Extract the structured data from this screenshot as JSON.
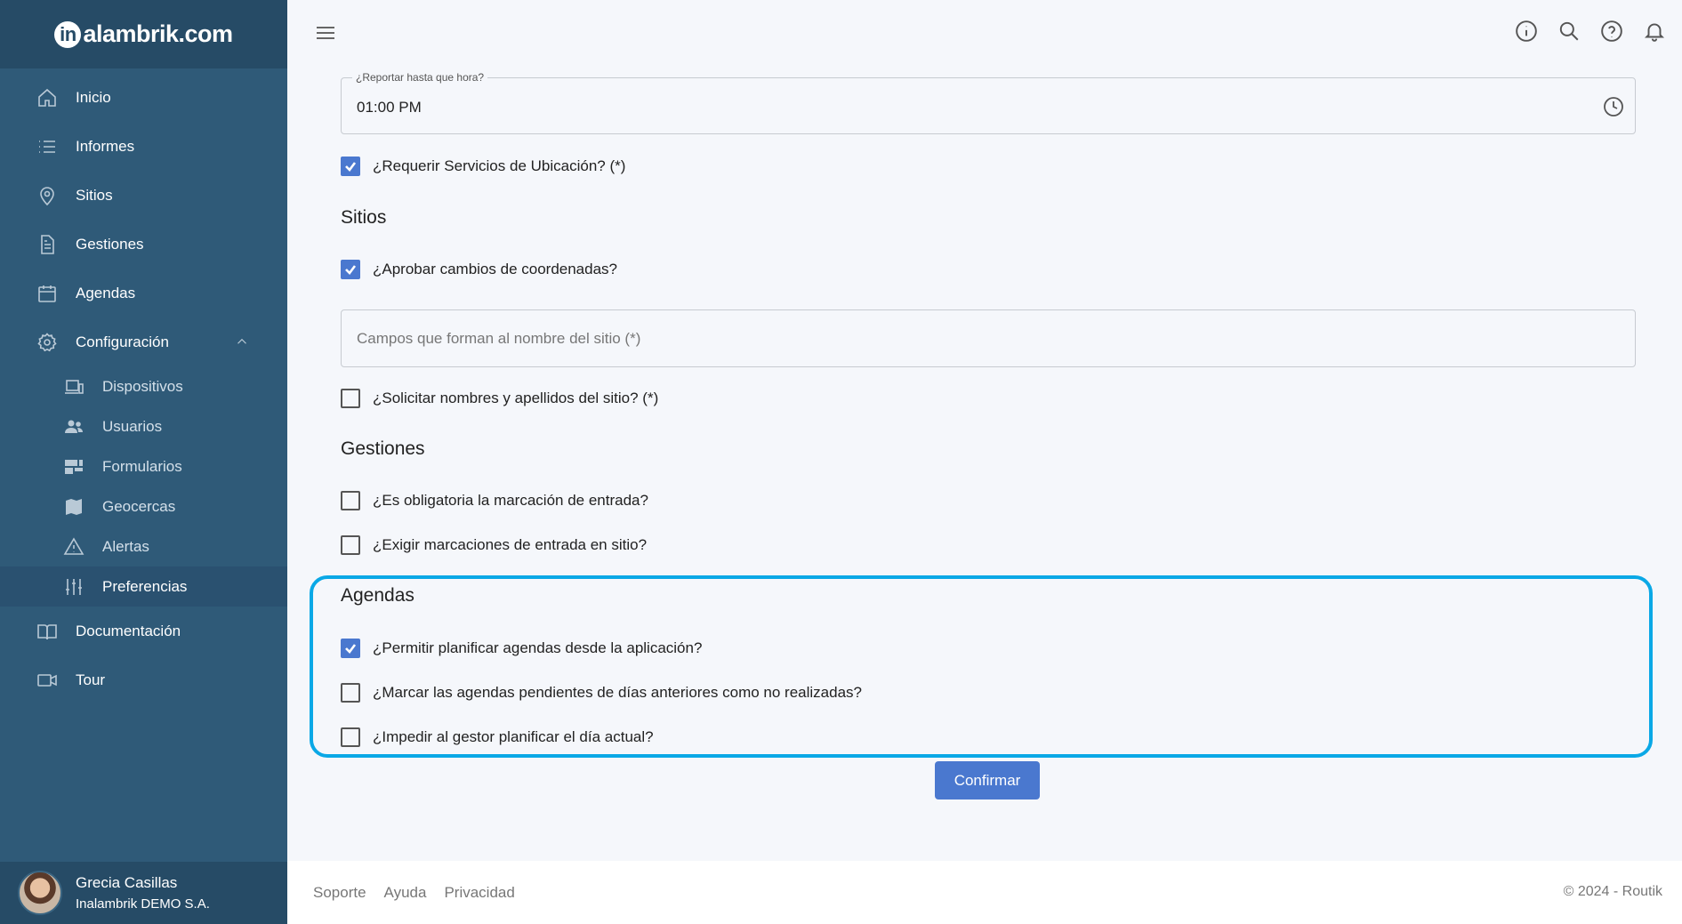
{
  "brand": {
    "logo_text": "alambrik.com",
    "logo_mark": "in"
  },
  "sidebar": {
    "items": [
      {
        "label": "Inicio"
      },
      {
        "label": "Informes"
      },
      {
        "label": "Sitios"
      },
      {
        "label": "Gestiones"
      },
      {
        "label": "Agendas"
      },
      {
        "label": "Configuración"
      }
    ],
    "config_sub": [
      {
        "label": "Dispositivos"
      },
      {
        "label": "Usuarios"
      },
      {
        "label": "Formularios"
      },
      {
        "label": "Geocercas"
      },
      {
        "label": "Alertas"
      },
      {
        "label": "Preferencias"
      }
    ],
    "bottom_items": [
      {
        "label": "Documentación"
      },
      {
        "label": "Tour"
      }
    ],
    "user": {
      "name": "Grecia Casillas",
      "org": "Inalambrik DEMO S.A."
    }
  },
  "form": {
    "report_until": {
      "legend": "¿Reportar hasta que hora?",
      "value": "01:00 PM"
    },
    "require_location": {
      "label": "¿Requerir Servicios de Ubicación? (*)",
      "checked": true
    },
    "sitios": {
      "title": "Sitios",
      "approve_coords": {
        "label": "¿Aprobar cambios de coordenadas?",
        "checked": true
      },
      "name_fields": {
        "placeholder": "Campos que forman al nombre del sitio (*)",
        "value": ""
      },
      "request_names": {
        "label": "¿Solicitar nombres y apellidos del sitio? (*)",
        "checked": false
      }
    },
    "gestiones": {
      "title": "Gestiones",
      "entry_required": {
        "label": "¿Es obligatoria la marcación de entrada?",
        "checked": false
      },
      "entry_on_site": {
        "label": "¿Exigir marcaciones de entrada en sitio?",
        "checked": false
      }
    },
    "agendas": {
      "title": "Agendas",
      "allow_plan_app": {
        "label": "¿Permitir planificar agendas desde la aplicación?",
        "checked": true
      },
      "mark_pending": {
        "label": "¿Marcar las agendas pendientes de días anteriores como no realizadas?",
        "checked": false
      },
      "prevent_today": {
        "label": "¿Impedir al gestor planificar el día actual?",
        "checked": false
      }
    },
    "confirm_label": "Confirmar"
  },
  "footer": {
    "links": [
      "Soporte",
      "Ayuda",
      "Privacidad"
    ],
    "copyright": "© 2024 - Routik"
  },
  "colors": {
    "sidebar": "#2f5a78",
    "accent": "#4a78cf",
    "highlight": "#0aa8e6"
  }
}
